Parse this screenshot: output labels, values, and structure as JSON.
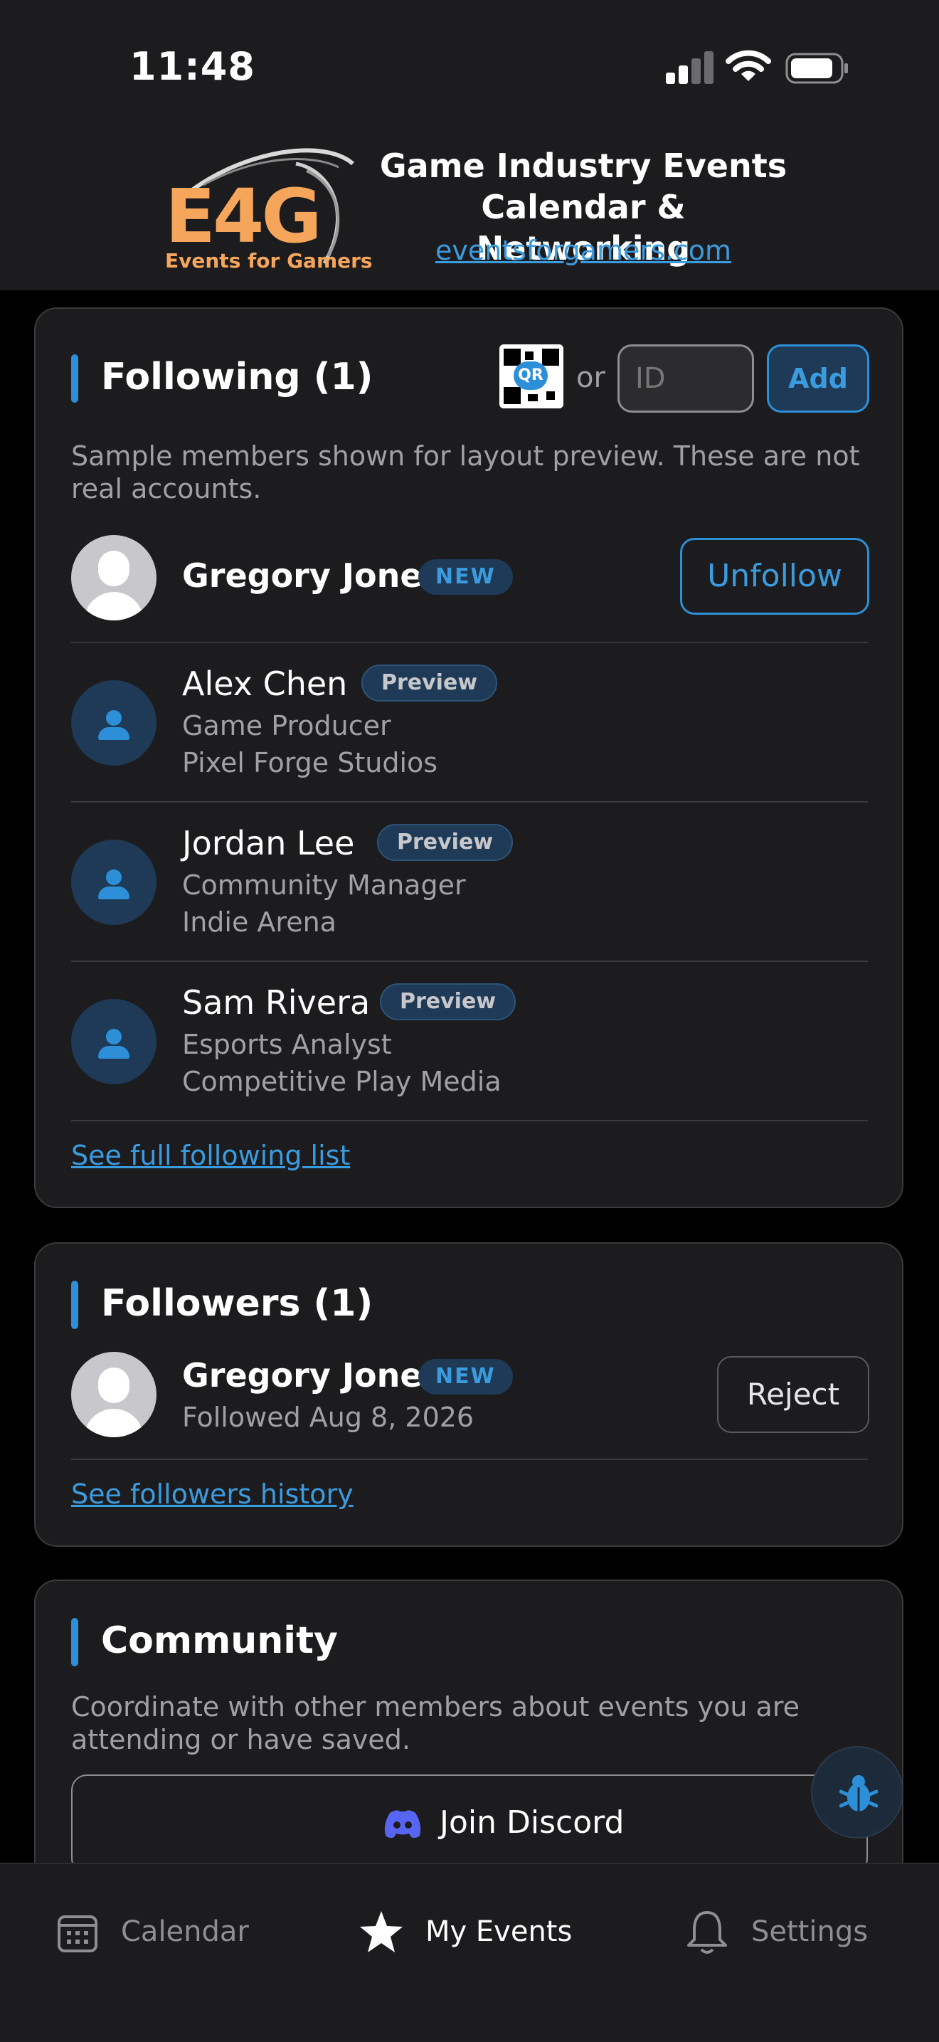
{
  "status_bar": {
    "time": "11:48"
  },
  "header": {
    "logo_text": "E4G",
    "logo_subtext": "Events for Gamers",
    "title_line1": "Game Industry Events",
    "title_line2": "Calendar & Networking",
    "website": "eventsforgamers.com"
  },
  "following": {
    "title": "Following (1)",
    "qr_label": "QR",
    "or_text": "or",
    "id_placeholder": "ID",
    "add_label": "Add",
    "notice": "Sample members shown for layout preview. These are not real accounts.",
    "primary": {
      "name": "Gregory Jones",
      "badge": "NEW",
      "action": "Unfollow"
    },
    "previews": [
      {
        "name": "Alex Chen",
        "badge": "Preview",
        "role": "Game Producer",
        "company": "Pixel Forge Studios"
      },
      {
        "name": "Jordan Lee",
        "badge": "Preview",
        "role": "Community Manager",
        "company": "Indie Arena"
      },
      {
        "name": "Sam Rivera",
        "badge": "Preview",
        "role": "Esports Analyst",
        "company": "Competitive Play Media"
      }
    ],
    "see_all": "See full following list"
  },
  "followers": {
    "title": "Followers (1)",
    "item": {
      "name": "Gregory Jones",
      "badge": "NEW",
      "detail": "Followed Aug 8, 2026",
      "action": "Reject"
    },
    "see_history": "See followers history"
  },
  "community": {
    "title": "Community",
    "description": "Coordinate with other members about events you are attending or have saved.",
    "discord_label": "Join Discord"
  },
  "tab_bar": {
    "tabs": [
      {
        "label": "Calendar",
        "icon": "calendar-icon",
        "active": false
      },
      {
        "label": "My Events",
        "icon": "star-icon",
        "active": true
      },
      {
        "label": "Settings",
        "icon": "bell-icon",
        "active": false
      }
    ]
  },
  "colors": {
    "accent": "#2d8fd8",
    "link": "#3b9bdf",
    "logo": "#f5a65b",
    "card_bg": "#1c1c1e",
    "page_bg": "#000000"
  }
}
